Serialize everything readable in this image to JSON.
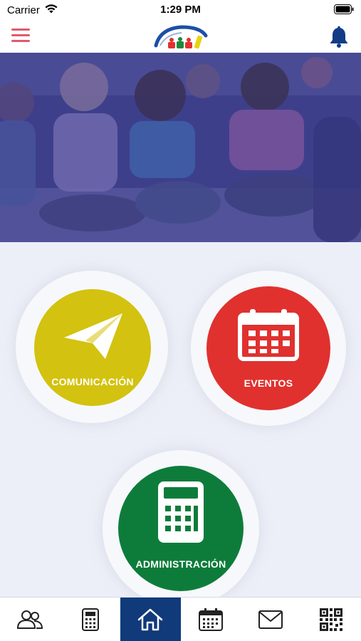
{
  "status_bar": {
    "carrier": "Carrier",
    "time": "1:29 PM"
  },
  "header": {
    "menu_icon": "hamburger-menu-icon",
    "logo": "school-logo",
    "notification_icon": "bell-icon",
    "colors": {
      "menu": "#e05a6d",
      "bell": "#123c86"
    }
  },
  "hero": {
    "image": "children-sitting-photo",
    "overlay_color": "#3d3f88"
  },
  "tiles": [
    {
      "id": "comunicacion",
      "label": "COMUNICACIÓN",
      "icon": "paper-plane-icon",
      "color": "#d3c20f"
    },
    {
      "id": "eventos",
      "label": "EVENTOS",
      "icon": "calendar-icon",
      "color": "#e0312f"
    },
    {
      "id": "administracion",
      "label": "ADMINISTRACIÓN",
      "icon": "calculator-icon",
      "color": "#0d7c3b"
    }
  ],
  "bottom_nav": {
    "active": "home",
    "active_color": "#103a7a",
    "items": [
      "users-icon",
      "calculator-icon",
      "home-icon",
      "calendar-icon",
      "mail-icon",
      "qr-code-icon"
    ]
  }
}
